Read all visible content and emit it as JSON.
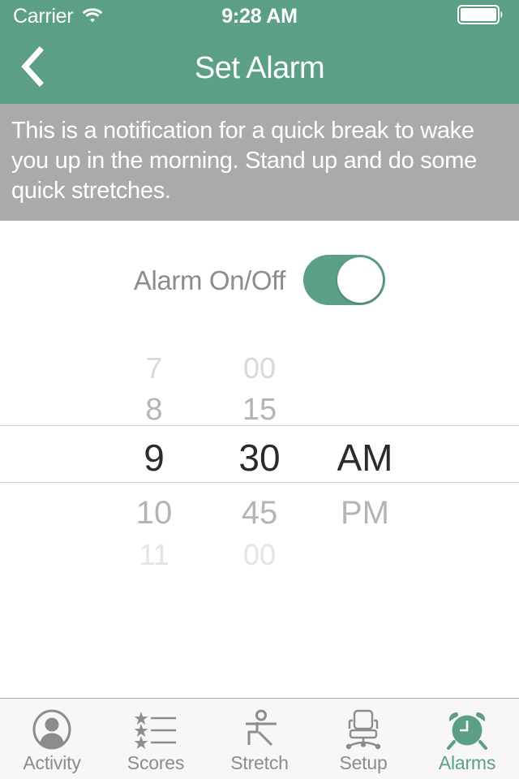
{
  "status_bar": {
    "carrier": "Carrier",
    "time": "9:28 AM",
    "wifi_icon": "wifi-icon",
    "battery_icon": "battery-full-icon"
  },
  "nav": {
    "title": "Set Alarm",
    "back_icon": "chevron-left-icon"
  },
  "notification": {
    "text": "This is a notification for a quick break to wake you up in the morning. Stand up and do some quick stretches."
  },
  "alarm_toggle": {
    "label": "Alarm On/Off",
    "state": "on"
  },
  "time_picker": {
    "hours": [
      "7",
      "8",
      "9",
      "10",
      "11"
    ],
    "minutes": [
      "00",
      "15",
      "30",
      "45",
      "00"
    ],
    "periods": [
      "",
      "",
      "AM",
      "PM",
      ""
    ],
    "selected_hour": "9",
    "selected_minute": "30",
    "selected_period": "AM"
  },
  "tabs": [
    {
      "label": "Activity",
      "icon": "person-circle-icon",
      "active": false
    },
    {
      "label": "Scores",
      "icon": "star-list-icon",
      "active": false
    },
    {
      "label": "Stretch",
      "icon": "stretching-person-icon",
      "active": false
    },
    {
      "label": "Setup",
      "icon": "office-chair-icon",
      "active": false
    },
    {
      "label": "Alarms",
      "icon": "alarm-clock-icon",
      "active": true
    }
  ],
  "colors": {
    "brand_green": "#5BA085",
    "banner_gray": "#AAAAAA",
    "inactive_gray": "#8C8C8C",
    "tab_bar_bg": "#F7F7F7"
  }
}
